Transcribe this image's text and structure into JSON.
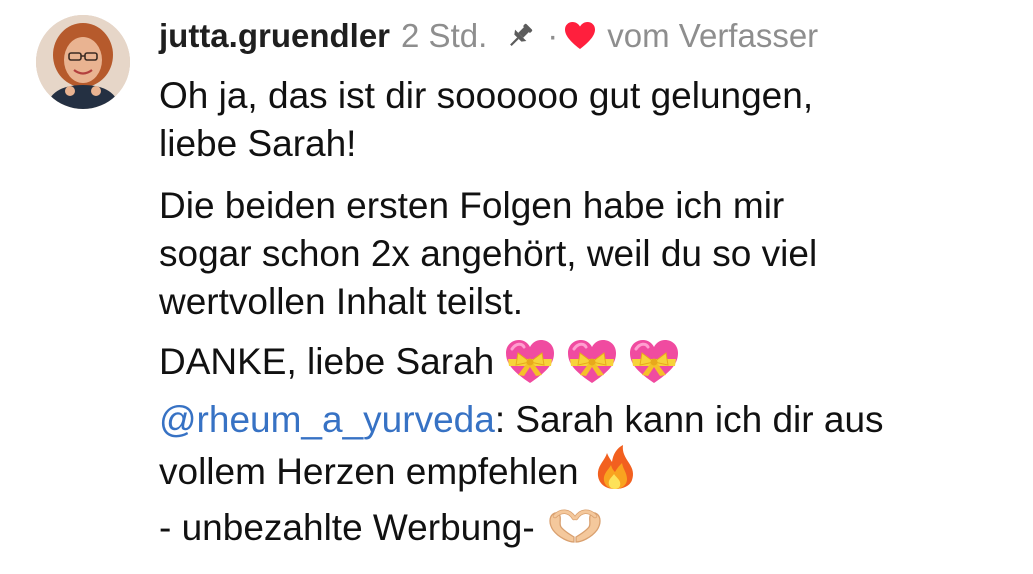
{
  "comment": {
    "username": "jutta.gruendler",
    "time": "2 Std.",
    "separator": "·",
    "author_like_label": "vom Verfasser",
    "lines": {
      "p1a": "Oh ja, das ist dir soooooo gut gelungen,",
      "p1b": "liebe Sarah!",
      "p2a": "Die beiden ersten Folgen habe ich mir",
      "p2b": "sogar schon 2x angehört, weil du so viel",
      "p2c": "wertvollen Inhalt teilst.",
      "p3": "DANKE, liebe Sarah",
      "p4_mention": "@rheum_a_yurveda",
      "p4_rest": ": Sarah kann ich dir aus",
      "p4b": "vollem Herzen empfehlen",
      "p5": "- unbezahlte Werbung-"
    }
  },
  "icons": {
    "pin": "pin-icon",
    "heart": "heart-icon",
    "gift_heart": "heart-with-ribbon-emoji",
    "fire": "fire-emoji",
    "hands": "heart-hands-emoji"
  },
  "colors": {
    "username": "#1f1f1f",
    "meta": "#8e8e8e",
    "heart": "#ff1f3d",
    "mention": "#3772c4",
    "text": "#111111"
  }
}
